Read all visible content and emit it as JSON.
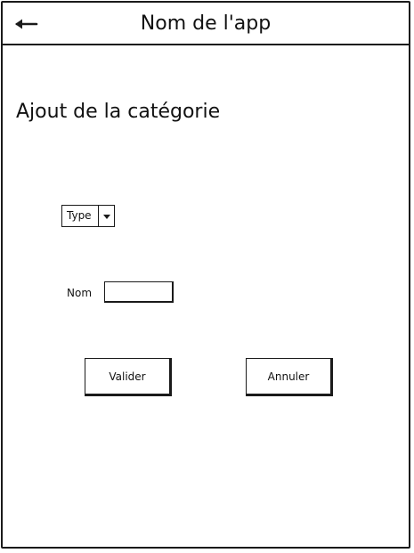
{
  "header": {
    "back_icon": "arrow-left-icon",
    "title": "Nom de l'app"
  },
  "page": {
    "title": "Ajout de la catégorie"
  },
  "form": {
    "type_select": {
      "selected": "Type",
      "icon": "caret-down-icon"
    },
    "name_field": {
      "label": "Nom",
      "value": ""
    },
    "validate_label": "Valider",
    "cancel_label": "Annuler"
  },
  "colors": {
    "stroke": "#1a1a1a",
    "background": "#ffffff"
  }
}
